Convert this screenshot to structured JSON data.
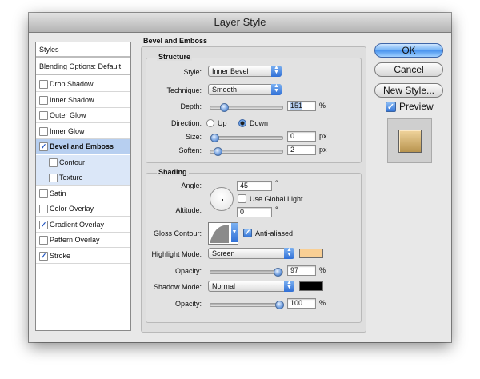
{
  "window": {
    "title": "Layer Style"
  },
  "styles_list": {
    "header": "Styles",
    "blending": "Blending Options: Default",
    "items": [
      {
        "label": "Drop Shadow",
        "checked": false,
        "indent": false,
        "selected": false
      },
      {
        "label": "Inner Shadow",
        "checked": false,
        "indent": false,
        "selected": false
      },
      {
        "label": "Outer Glow",
        "checked": false,
        "indent": false,
        "selected": false
      },
      {
        "label": "Inner Glow",
        "checked": false,
        "indent": false,
        "selected": false
      },
      {
        "label": "Bevel and Emboss",
        "checked": true,
        "indent": false,
        "selected": true
      },
      {
        "label": "Contour",
        "checked": false,
        "indent": true,
        "selected": false
      },
      {
        "label": "Texture",
        "checked": false,
        "indent": true,
        "selected": false
      },
      {
        "label": "Satin",
        "checked": false,
        "indent": false,
        "selected": false
      },
      {
        "label": "Color Overlay",
        "checked": false,
        "indent": false,
        "selected": false
      },
      {
        "label": "Gradient Overlay",
        "checked": true,
        "indent": false,
        "selected": false
      },
      {
        "label": "Pattern Overlay",
        "checked": false,
        "indent": false,
        "selected": false
      },
      {
        "label": "Stroke",
        "checked": true,
        "indent": false,
        "selected": false
      }
    ]
  },
  "panel": {
    "title": "Bevel and Emboss"
  },
  "structure": {
    "title": "Structure",
    "style_label": "Style:",
    "style_value": "Inner Bevel",
    "technique_label": "Technique:",
    "technique_value": "Smooth",
    "depth_label": "Depth:",
    "depth_value": "151",
    "depth_unit": "%",
    "depth_level": 0.15,
    "direction_label": "Direction:",
    "direction_up": "Up",
    "direction_down": "Down",
    "size_label": "Size:",
    "size_value": "0",
    "size_unit": "px",
    "size_level": 0.0,
    "soften_label": "Soften:",
    "soften_value": "2",
    "soften_unit": "px",
    "soften_level": 0.05
  },
  "shading": {
    "title": "Shading",
    "angle_label": "Angle:",
    "angle_value": "45",
    "angle_unit": "°",
    "global_light_label": "Use Global Light",
    "altitude_label": "Altitude:",
    "altitude_value": "0",
    "altitude_unit": "°",
    "gloss_label": "Gloss Contour:",
    "anti_aliased_label": "Anti-aliased",
    "highlight_mode_label": "Highlight Mode:",
    "highlight_mode_value": "Screen",
    "highlight_color": "#f9cf94",
    "highlight_opacity_label": "Opacity:",
    "highlight_opacity_value": "97",
    "highlight_opacity_unit": "%",
    "highlight_opacity_level": 0.97,
    "shadow_mode_label": "Shadow Mode:",
    "shadow_mode_value": "Normal",
    "shadow_color": "#000000",
    "shadow_opacity_label": "Opacity:",
    "shadow_opacity_value": "100",
    "shadow_opacity_unit": "%",
    "shadow_opacity_level": 1.0
  },
  "buttons": {
    "ok": "OK",
    "cancel": "Cancel",
    "new_style": "New Style..."
  },
  "preview": {
    "label": "Preview",
    "checked": true
  }
}
